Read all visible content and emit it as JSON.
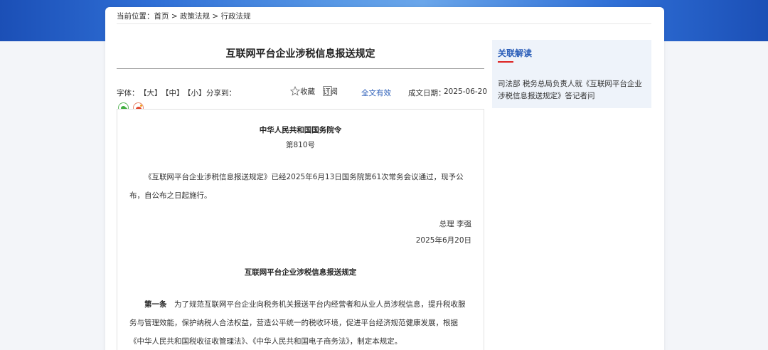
{
  "breadcrumb": {
    "prefix": "当前位置：",
    "items": [
      "首页",
      "政策法规",
      "行政法规"
    ],
    "separator": " > "
  },
  "article": {
    "title": "互联网平台企业涉税信息报送规定",
    "toolbar": {
      "font_label": "字体：",
      "size_large": "【大】",
      "size_medium": "【中】",
      "size_small": "【小】",
      "share_label": "分享到：",
      "favorite": "收藏",
      "subscribe": "订阅",
      "validity": "全文有效",
      "date_label": "成文日期：",
      "date_value": "2025-06-20"
    },
    "body": {
      "issuer": "中华人民共和国国务院令",
      "number": "第810号",
      "intro": "《互联网平台企业涉税信息报送规定》已经2025年6月13日国务院第61次常务会议通过，现予公布，自公布之日起施行。",
      "signer": "总理 李强",
      "sign_date": "2025年6月20日",
      "doc_title": "互联网平台企业涉税信息报送规定",
      "article1_label": "第一条",
      "article1_text": "　为了规范互联网平台企业向税务机关报送平台内经营者和从业人员涉税信息，提升税收服务与管理效能，保护纳税人合法权益，营造公平统一的税收环境，促进平台经济规范健康发展，根据《中华人民共和国税收征收管理法》、《中华人民共和国电子商务法》，制定本规定。"
    }
  },
  "sidebar": {
    "title": "关联解读",
    "links": [
      "司法部 税务总局负责人就《互联网平台企业涉税信息报送规定》答记者问"
    ]
  },
  "colors": {
    "accent_blue": "#2a5db8",
    "accent_red": "#dd2222",
    "banner_blue": "#2f6fd6"
  },
  "icons": {
    "favorite": "star-outline-icon",
    "subscribe": "subscribe-icon",
    "share_wechat": "wechat-icon",
    "share_weibo": "weibo-icon"
  }
}
